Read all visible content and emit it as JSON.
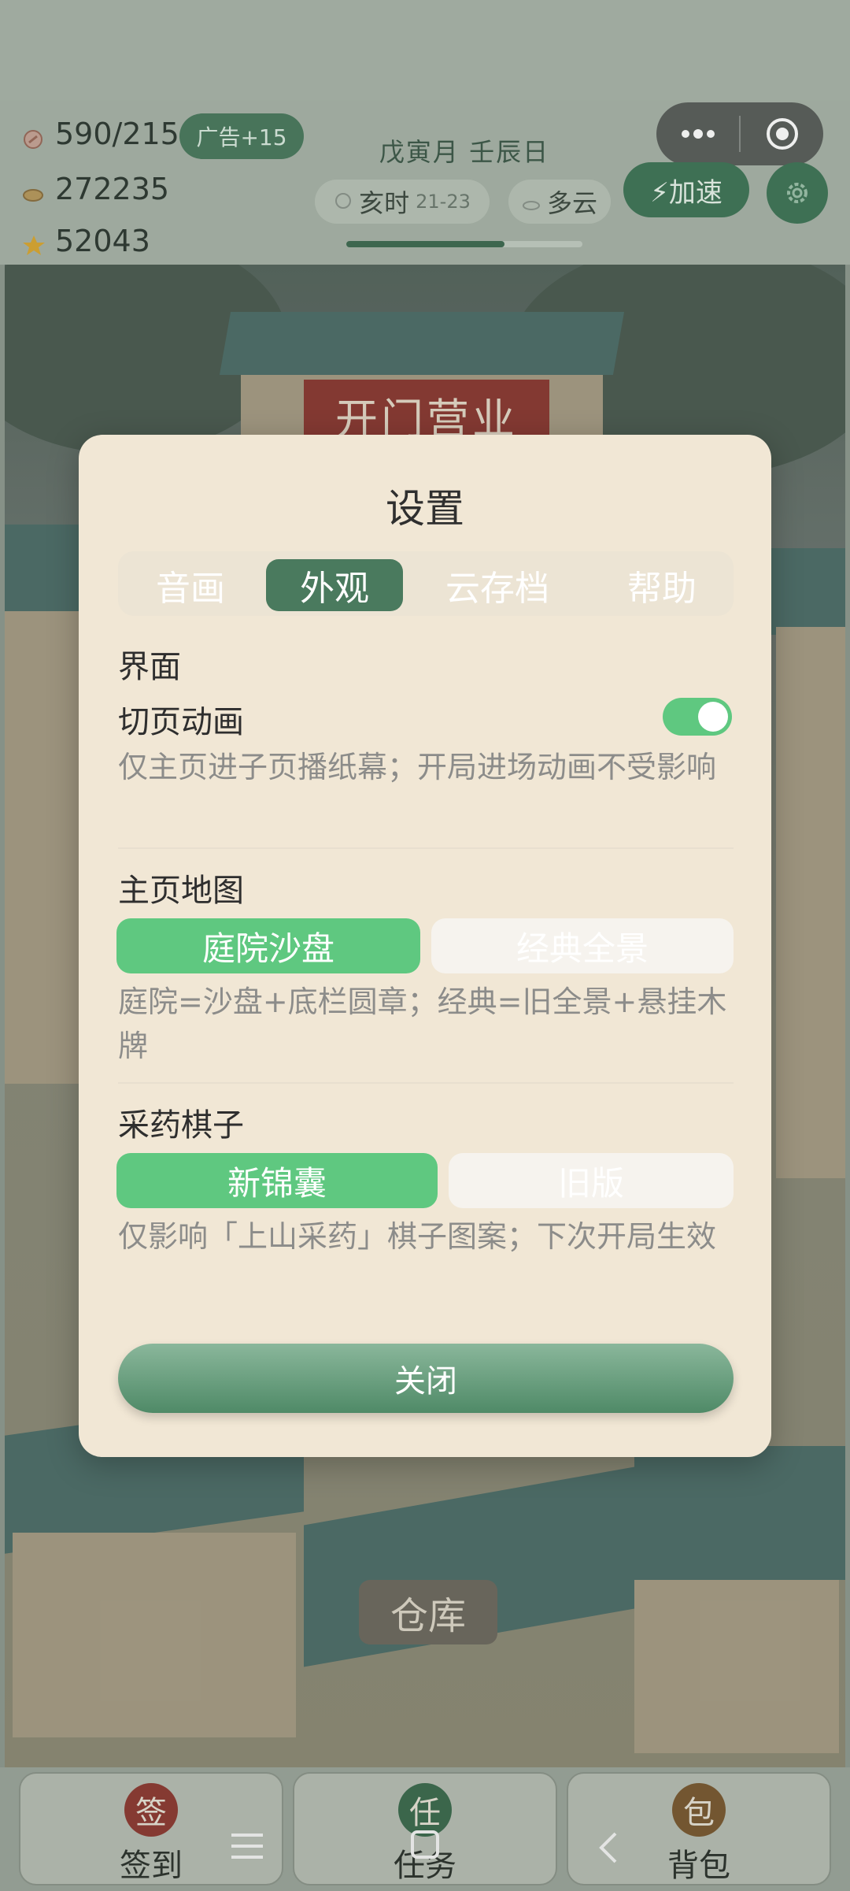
{
  "resources": {
    "energy": "590/215",
    "coins": "272235",
    "stars": "52043",
    "ad_button": "广告+15"
  },
  "calendar": {
    "date": "戊寅月 壬辰日",
    "time_label": "亥时",
    "time_range": "21-23",
    "weather": "多云",
    "day_progress": 0.67
  },
  "actions": {
    "speed_up": "⚡加速"
  },
  "scene": {
    "shop_sign": "开门营业",
    "warehouse": "仓库"
  },
  "bottom_nav": [
    {
      "badge": "签",
      "label": "签到",
      "badge_color": "#8e3b34"
    },
    {
      "badge": "任",
      "label": "任务",
      "badge_color": "#3d6b4f"
    },
    {
      "badge": "包",
      "label": "背包",
      "badge_color": "#7a5a32"
    }
  ],
  "settings": {
    "title": "设置",
    "tabs": [
      "音画",
      "外观",
      "云存档",
      "帮助"
    ],
    "active_tab": "外观",
    "section_interface": "界面",
    "page_anim": {
      "label": "切页动画",
      "enabled": true,
      "desc": "仅主页进子页播纸幕；开局进场动画不受影响"
    },
    "home_map": {
      "label": "主页地图",
      "options": [
        "庭院沙盘",
        "经典全景"
      ],
      "selected": "庭院沙盘",
      "desc": "庭院=沙盘+底栏圆章；经典=旧全景+悬挂木牌"
    },
    "herb_piece": {
      "label": "采药棋子",
      "options": [
        "新锦囊",
        "旧版"
      ],
      "selected": "新锦囊",
      "desc": "仅影响「上山采药」棋子图案；下次开局生效"
    },
    "close": "关闭"
  },
  "colors": {
    "accent_green": "#5fc880",
    "dark_green": "#4a7a5e",
    "modal_bg": "#f1e7d5"
  }
}
